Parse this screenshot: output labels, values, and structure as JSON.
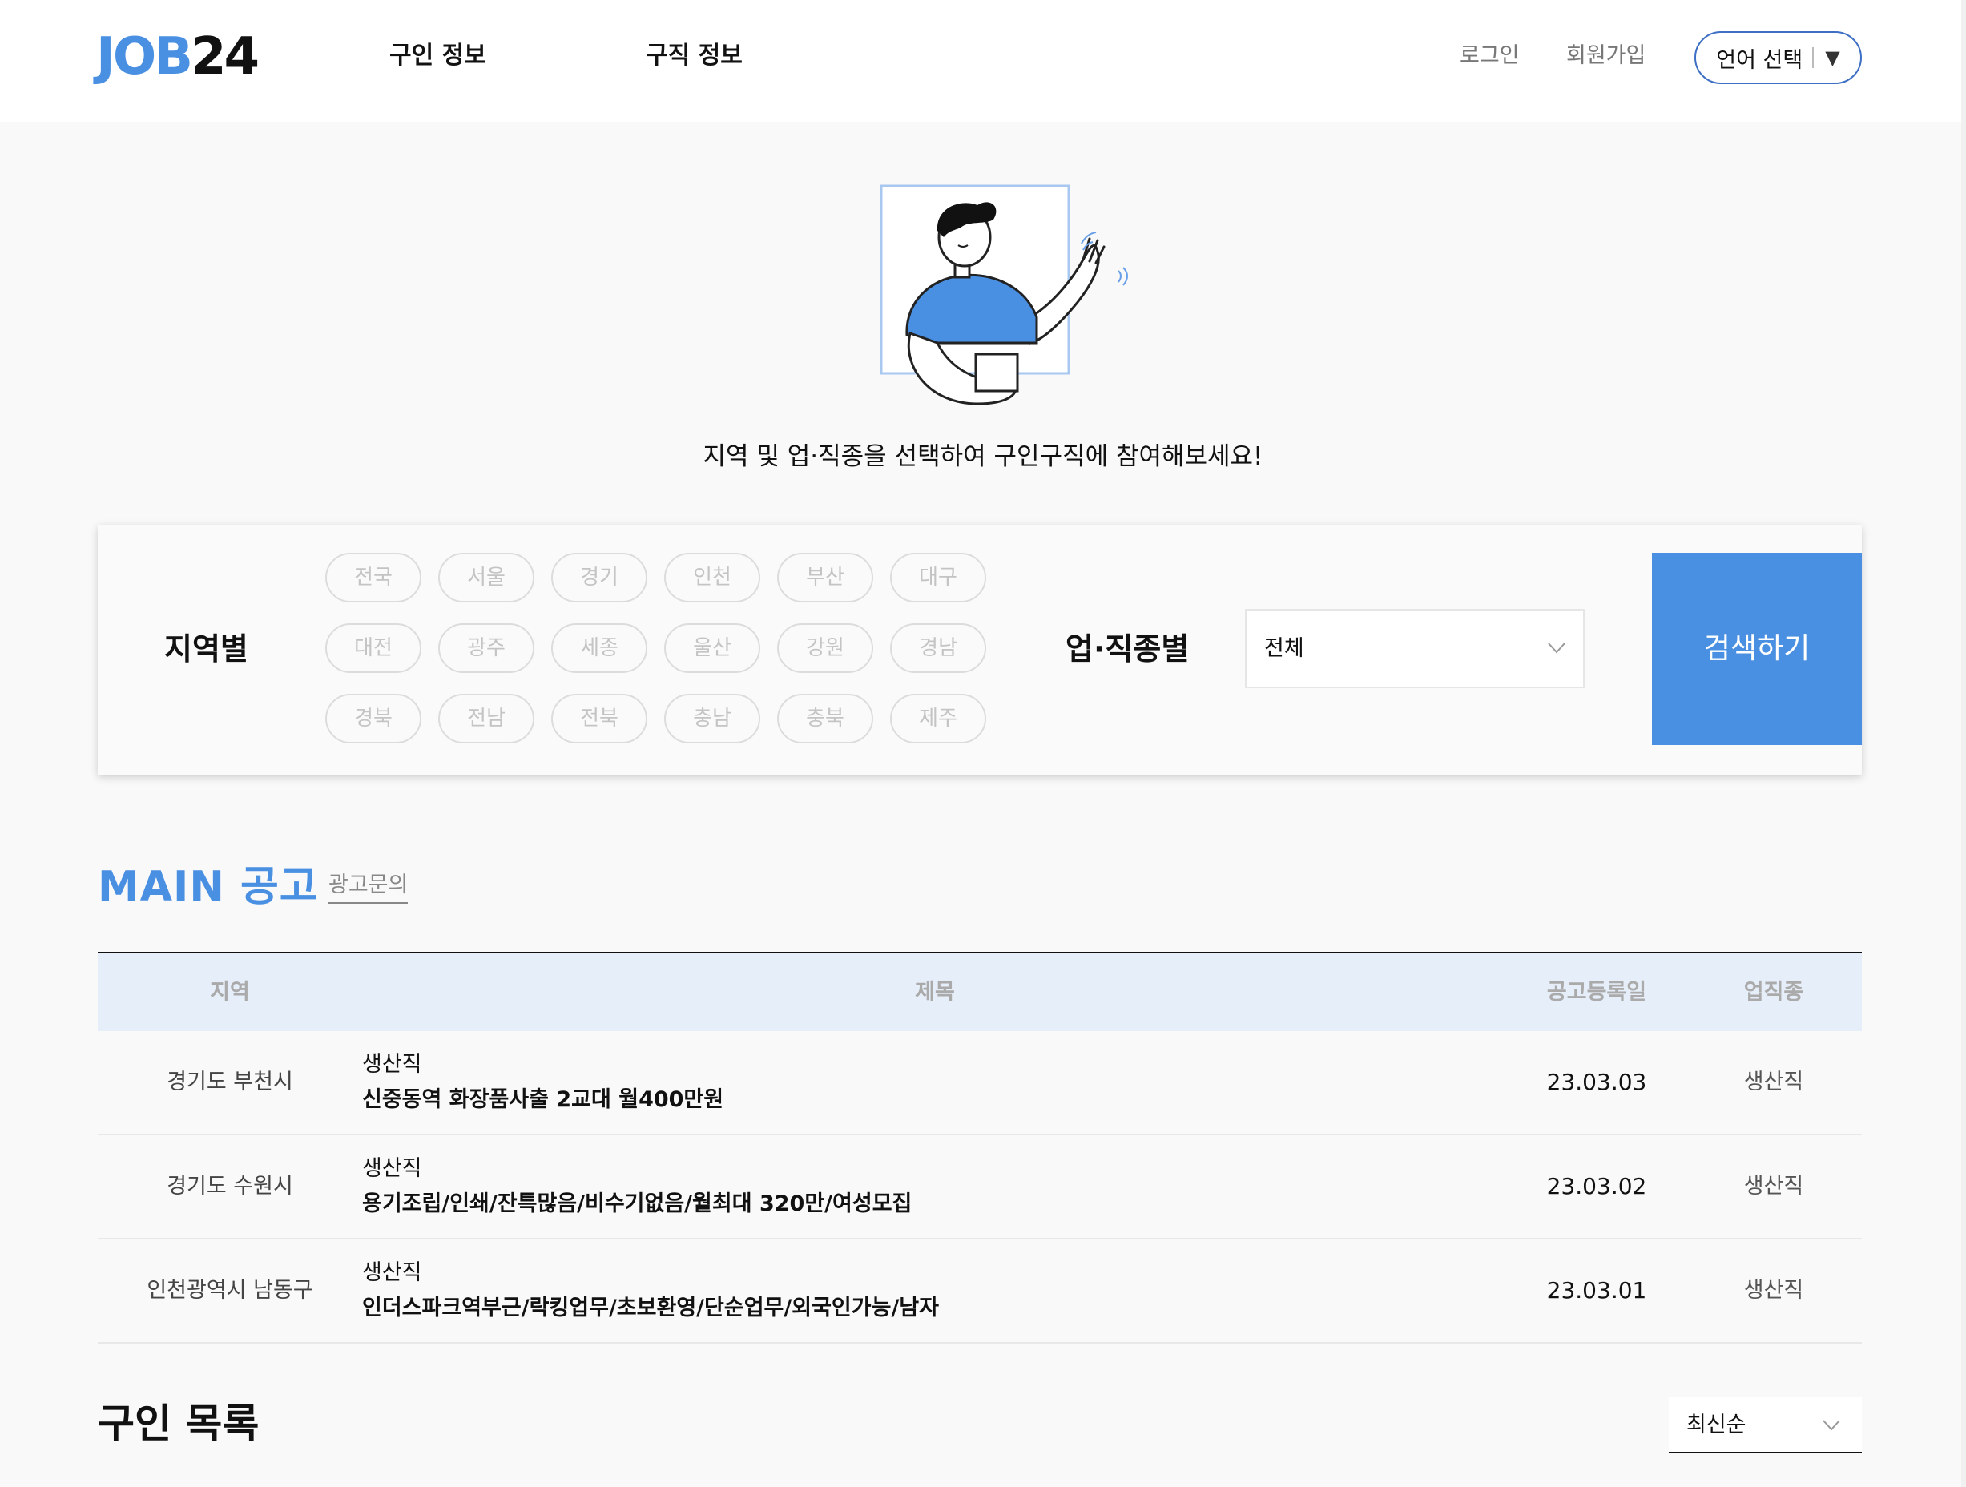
{
  "header": {
    "logo_job": "JOB",
    "logo_num": "24",
    "nav": [
      "구인 정보",
      "구직 정보"
    ],
    "login": "로그인",
    "signup": "회원가입",
    "language_label": "언어 선택",
    "language_arrow": "▼"
  },
  "hero": {
    "text": "지역 및 업·직종을 선택하여 구인구직에 참여해보세요!"
  },
  "search": {
    "region_label": "지역별",
    "regions": [
      "전국",
      "서울",
      "경기",
      "인천",
      "부산",
      "대구",
      "대전",
      "광주",
      "세종",
      "울산",
      "강원",
      "경남",
      "경북",
      "전남",
      "전북",
      "충남",
      "충북",
      "제주"
    ],
    "job_label": "업·직종별",
    "job_selected": "전체",
    "button": "검색하기"
  },
  "main_ads": {
    "title": "MAIN 공고",
    "ad_link": "광고문의",
    "columns": [
      "지역",
      "제목",
      "공고등록일",
      "업직종"
    ],
    "rows": [
      {
        "region": "경기도 부천시",
        "category": "생산직",
        "title": "신중동역 화장품사출 2교대 월400만원",
        "date": "23.03.03",
        "job": "생산직"
      },
      {
        "region": "경기도 수원시",
        "category": "생산직",
        "title": "용기조립/인쇄/잔특많음/비수기없음/월최대 320만/여성모집",
        "date": "23.03.02",
        "job": "생산직"
      },
      {
        "region": "인천광역시 남동구",
        "category": "생산직",
        "title": "인더스파크역부근/락킹업무/초보환영/단순업무/외국인가능/남자",
        "date": "23.03.01",
        "job": "생산직"
      }
    ]
  },
  "job_list": {
    "title": "구인 목록",
    "sort_selected": "최신순"
  },
  "colors": {
    "accent": "#4a90e2",
    "table_header_bg": "#e6eef9",
    "lang_border": "#3d6fc4"
  }
}
